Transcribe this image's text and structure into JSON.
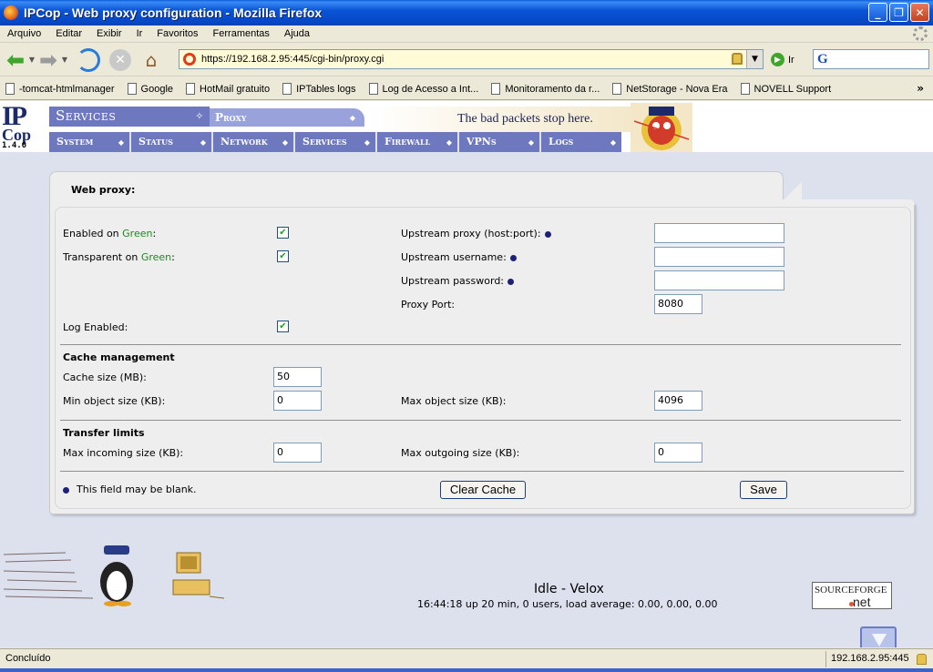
{
  "window": {
    "title": "IPCop - Web proxy configuration - Mozilla Firefox",
    "controls": [
      "_",
      "❐",
      "✕"
    ]
  },
  "menu": [
    "Arquivo",
    "Editar",
    "Exibir",
    "Ir",
    "Favoritos",
    "Ferramentas",
    "Ajuda"
  ],
  "navbar": {
    "url": "https://192.168.2.95:445/cgi-bin/proxy.cgi",
    "go_label": "Ir",
    "search_value": ""
  },
  "bookmarks": [
    "-tomcat-htmlmanager",
    "Google",
    "HotMail gratuito",
    "IPTables logs",
    "Log de Acesso a Int...",
    "Monitoramento da r...",
    "NetStorage - Nova Era",
    "NOVELL Support"
  ],
  "bookmarks_more": "»",
  "header": {
    "logo_ip": "IP",
    "logo_cop": "Cop",
    "version": "1.4.6",
    "section": "Services",
    "subsection": "Proxy",
    "slogan": "The bad packets stop here.",
    "nav": [
      "System",
      "Status",
      "Network",
      "Services",
      "Firewall",
      "VPNs",
      "Logs"
    ]
  },
  "form": {
    "title": "Web proxy:",
    "enabled_green_prefix": "Enabled on ",
    "transparent_green_prefix": "Transparent on ",
    "green_word": "Green",
    "colon": ":",
    "enabled_green": true,
    "transparent_green": true,
    "log_enabled_label": "Log Enabled:",
    "log_enabled": true,
    "upstream_proxy_label": "Upstream proxy (host:port):",
    "upstream_proxy_value": "",
    "upstream_username_label": "Upstream username:",
    "upstream_username_value": "",
    "upstream_password_label": "Upstream password:",
    "upstream_password_value": "",
    "proxy_port_label": "Proxy Port:",
    "proxy_port_value": "8080",
    "cache_heading": "Cache management",
    "cache_size_label": "Cache size (MB):",
    "cache_size_value": "50",
    "min_object_label": "Min object size (KB):",
    "min_object_value": "0",
    "max_object_label": "Max object size (KB):",
    "max_object_value": "4096",
    "transfer_heading": "Transfer limits",
    "max_incoming_label": "Max incoming size (KB):",
    "max_incoming_value": "0",
    "max_outgoing_label": "Max outgoing size (KB):",
    "max_outgoing_value": "0",
    "blank_note": "This field may be blank.",
    "clear_cache_label": "Clear Cache",
    "save_label": "Save"
  },
  "footer": {
    "host_title": "Idle - Velox",
    "uptime": "16:44:18 up 20 min, 0 users, load average: 0.00, 0.00, 0.00",
    "sf_text1": "SOURCEFORGE",
    "sf_text2": "net"
  },
  "status": {
    "text": "Concluído",
    "host": "192.168.2.95:445"
  },
  "colors": {
    "accent": "#6e78bf",
    "green_label": "#1c8a1c",
    "page_bg": "#dde1ee"
  }
}
